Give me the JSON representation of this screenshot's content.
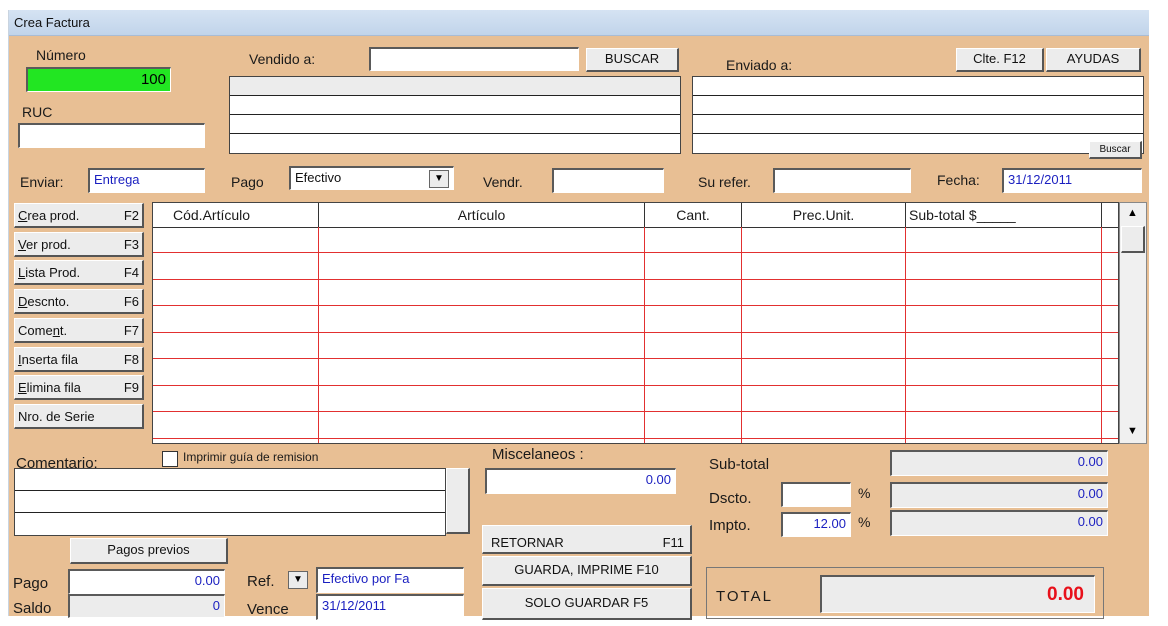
{
  "window": {
    "title": "Crea Factura"
  },
  "header": {
    "numero_label": "Número",
    "numero_value": "100",
    "ruc_label": "RUC",
    "vendido_label": "Vendido a:",
    "buscar_label": "BUSCAR",
    "enviado_label": "Enviado a:",
    "clte_label": "Clte. F12",
    "ayudas_label": "AYUDAS",
    "buscar_small": "Buscar"
  },
  "fields": {
    "enviar_label": "Enviar:",
    "enviar_value": "Entrega",
    "pago_label": "Pago",
    "pago_value": "Efectivo",
    "vendr_label": "Vendr.",
    "su_refer_label": "Su refer.",
    "fecha_label": "Fecha:",
    "fecha_value": "31/12/2011"
  },
  "side_buttons": [
    {
      "label": "Crea prod.",
      "key": "F2",
      "u": "C"
    },
    {
      "label": "Ver prod.",
      "key": "F3",
      "u": "V"
    },
    {
      "label": "Lista  Prod.",
      "key": "F4",
      "u": "L"
    },
    {
      "label": "Descnto.",
      "key": "F6",
      "u": "D"
    },
    {
      "label": "Coment.",
      "key": "F7",
      "u": "n"
    },
    {
      "label": "Inserta fila",
      "key": "F8",
      "u": "I"
    },
    {
      "label": "Elimina fila",
      "key": "F9",
      "u": "E"
    },
    {
      "label": "Nro. de Serie",
      "key": "",
      "u": ""
    }
  ],
  "grid": {
    "columns": [
      "Cód.Artículo",
      "Artículo",
      "Cant.",
      "Prec.Unit.",
      "Sub-total  $_____"
    ],
    "rows": 8
  },
  "comment": {
    "comentario_label": "Comentario:",
    "imprimir_label": "Imprimir guía de remision",
    "imprimir_checked": false
  },
  "misc": {
    "miscelaneos_label": "Miscelaneos :",
    "miscelaneos_value": "0.00"
  },
  "totals": {
    "subtotal_label": "Sub-total",
    "subtotal_value": "0.00",
    "dscto_label": "Dscto.",
    "dscto_pct": "%",
    "dscto_value": "0.00",
    "impto_label": "Impto.",
    "impto_rate": "12.00",
    "impto_pct": "%",
    "impto_value": "0.00",
    "total_label": "TOTAL",
    "total_value": "0.00"
  },
  "actions": {
    "retornar": "RETORNAR",
    "retornar_key": "F11",
    "guarda": "GUARDA, IMPRIME F10",
    "solo": "SOLO GUARDAR  F5"
  },
  "payment": {
    "pagos_previos": "Pagos previos",
    "pago_label": "Pago",
    "pago_value": "0.00",
    "saldo_label": "Saldo",
    "saldo_value": "0",
    "ref_label": "Ref.",
    "ref_value": "Efectivo por Fa",
    "vence_label": "Vence",
    "vence_value": "31/12/2011"
  },
  "colors": {
    "window_bg": "#e8bf94",
    "numero_bg": "#22e622",
    "grid_lines": "#e23030",
    "total_text": "#e8101a",
    "value_text": "#1a1fc0"
  }
}
